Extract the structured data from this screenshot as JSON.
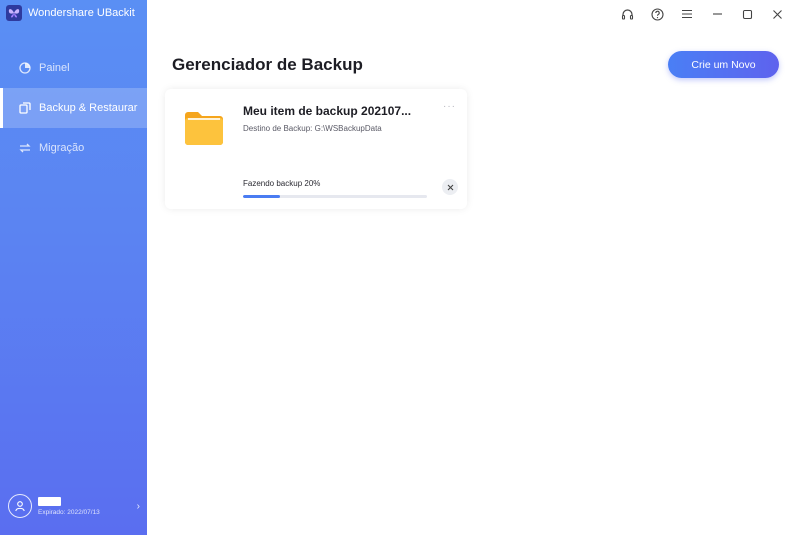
{
  "app": {
    "name": "Wondershare UBackit",
    "logo_icon": "butterfly-icon"
  },
  "sidebar": {
    "items": [
      {
        "label": "Painel",
        "icon": "dashboard-icon",
        "active": false
      },
      {
        "label": "Backup & Restaurar",
        "icon": "backup-icon",
        "active": true
      },
      {
        "label": "Migração",
        "icon": "migration-icon",
        "active": false
      }
    ],
    "user": {
      "expiry": "Expirado: 2022/07/13"
    }
  },
  "window_controls": [
    "headset-icon",
    "help-icon",
    "menu-icon",
    "minimize-icon",
    "maximize-icon",
    "close-icon"
  ],
  "main": {
    "title": "Gerenciador de Backup",
    "create_button_label": "Crie um Novo"
  },
  "backup_card": {
    "title": "Meu item de backup 202107...",
    "destination": "Destino de Backup: G:\\WSBackupData",
    "status": "Fazendo backup 20%",
    "progress_percent": 20,
    "more_label": "···"
  },
  "colors": {
    "sidebar_top": "#5a8ff4",
    "sidebar_bottom": "#5a6ef0",
    "accent": "#4a7cf2",
    "folder": "#fbb928"
  }
}
